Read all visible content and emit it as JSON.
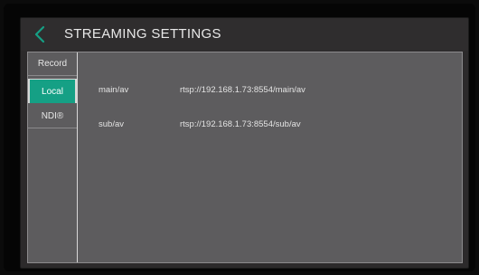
{
  "header": {
    "back_icon": "chevron-left-icon",
    "title": "STREAMING SETTINGS",
    "accent_color": "#15a085"
  },
  "sidebar": {
    "tabs": [
      {
        "label": "Record",
        "active": false
      },
      {
        "label": "Local",
        "active": true
      },
      {
        "label": "NDI®",
        "active": false
      }
    ]
  },
  "streams": [
    {
      "name": "main/av",
      "url": "rtsp://192.168.1.73:8554/main/av"
    },
    {
      "name": "sub/av",
      "url": "rtsp://192.168.1.73:8554/sub/av"
    }
  ]
}
